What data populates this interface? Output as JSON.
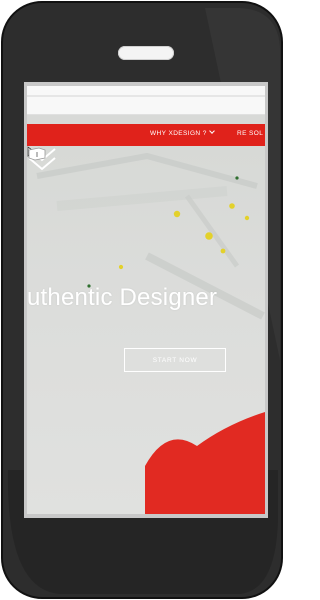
{
  "nav": {
    "why_label": "WHY XDESIGN ?",
    "re_label": "RE SOL"
  },
  "hero": {
    "headline": "uthentic Designer",
    "cta_label": "START NOW"
  },
  "colors": {
    "nav_red": "#e0221b",
    "phone_body": "#2b2b2b",
    "hero_bg": "#d8d9d7"
  },
  "icons": {
    "scroll_down": "double-chevron-down-icon",
    "cursor": "mouse-pointer-icon",
    "speaker": "speaker-slot"
  }
}
